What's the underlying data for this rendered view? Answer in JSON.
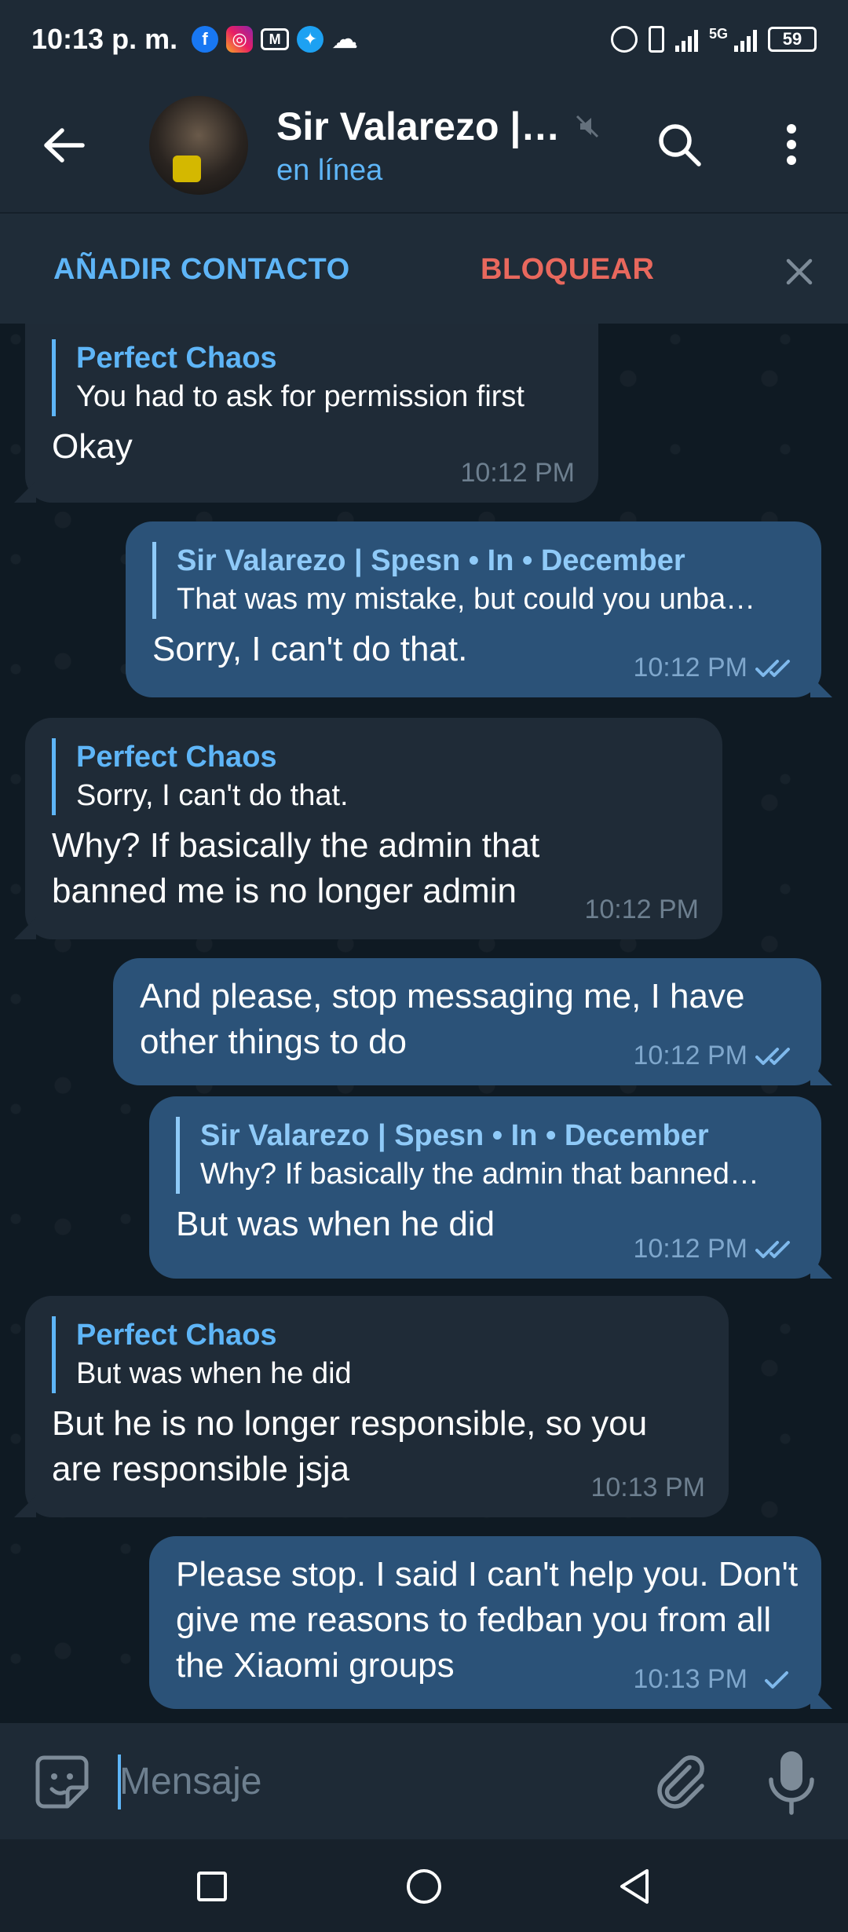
{
  "status_bar": {
    "time": "10:13 p. m.",
    "network": "5G",
    "battery": "59",
    "icons": [
      "facebook-icon",
      "instagram-icon",
      "gmail-icon",
      "twitter-icon",
      "cloud-icon",
      "alarm-icon",
      "vibrate-icon",
      "signal-icon",
      "battery-icon"
    ]
  },
  "header": {
    "title": "Sir Valarezo |…",
    "status": "en línea"
  },
  "action_bar": {
    "add_contact": "AÑADIR CONTACTO",
    "block": "BLOQUEAR"
  },
  "messages": [
    {
      "direction": "in",
      "reply_name": "Perfect Chaos",
      "reply_text": "You had to ask for permission first",
      "text": "Okay",
      "time": "10:12 PM"
    },
    {
      "direction": "out",
      "reply_name": "Sir Valarezo | Spesn • In • December",
      "reply_text": "That was my mistake, but could you unba…",
      "text": "Sorry, I can't do that.",
      "time": "10:12 PM",
      "status": "read"
    },
    {
      "direction": "in",
      "reply_name": "Perfect Chaos",
      "reply_text": "Sorry, I can't do that.",
      "text": "Why? If basically the admin that banned me is no longer admin",
      "time": "10:12 PM"
    },
    {
      "direction": "out",
      "text": "And please, stop messaging me, I have other things to do",
      "time": "10:12 PM",
      "status": "read"
    },
    {
      "direction": "out",
      "reply_name": "Sir Valarezo | Spesn • In • December",
      "reply_text": "Why? If basically the admin that banned…",
      "text": "But was when he did",
      "time": "10:12 PM",
      "status": "read"
    },
    {
      "direction": "in",
      "reply_name": "Perfect Chaos",
      "reply_text": "But was when he did",
      "text": "But he is no longer responsible, so you are responsible jsja",
      "time": "10:13 PM"
    },
    {
      "direction": "out",
      "text": "Please stop. I said I can't help you. Don't give me reasons to fedban you from all the Xiaomi groups",
      "time": "10:13 PM",
      "status": "sent"
    }
  ],
  "input": {
    "placeholder": "Mensaje",
    "value": ""
  },
  "colors": {
    "accent": "#5eb5f7",
    "danger": "#e8685d",
    "bubble_in": "#1f2b37",
    "bubble_out": "#2b5278",
    "header_bg": "#1e2a36"
  }
}
